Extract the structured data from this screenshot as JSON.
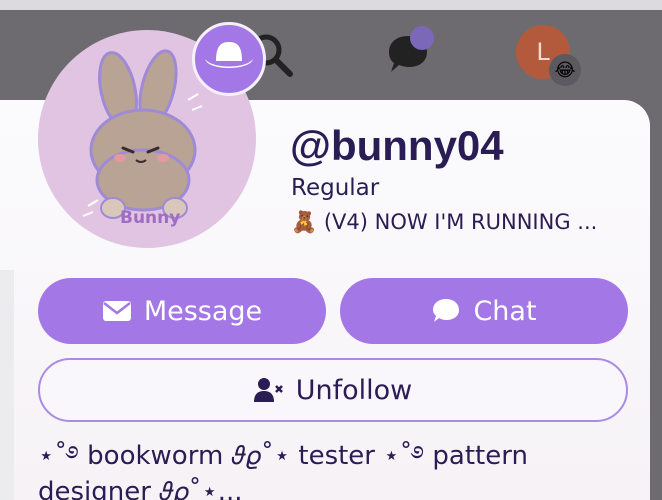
{
  "nav": {
    "search_icon": "search-icon",
    "chat_icon": "chat-bubble-icon",
    "user_avatar_letter": "L",
    "user_status_emoji": "😂",
    "colors": {
      "background": "#6e6b70",
      "avatar": "#b45a3c"
    }
  },
  "profile": {
    "username": "@bunny04",
    "rank": "Regular",
    "title": "🧸 (V4) NOW I'M RUNNING ...",
    "avatar_text": "Bunny",
    "badge_icon": "cowboy-hat-icon",
    "bio": "⋆˚࿔ bookworm 𝜗𝜚˚⋆ tester ⋆˚࿔ pattern designer 𝜗𝜚˚⋆..."
  },
  "actions": {
    "message_label": "Message",
    "chat_label": "Chat",
    "unfollow_label": "Unfollow"
  },
  "theme": {
    "accent": "#a377e6",
    "text": "#2a1d55",
    "card": "#fbfbfd",
    "avatar_bg": "#e1c4e2"
  }
}
